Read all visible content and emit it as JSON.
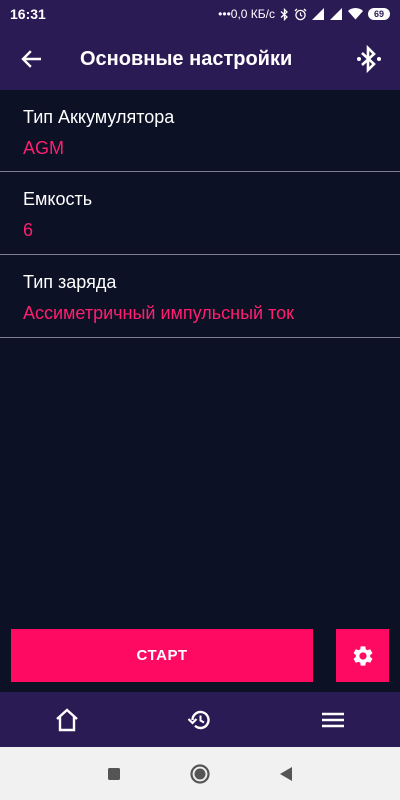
{
  "status_bar": {
    "time": "16:31",
    "network_speed": "0,0 КБ/с",
    "battery_level": "69"
  },
  "app_bar": {
    "title": "Основные настройки"
  },
  "settings": [
    {
      "label": "Тип Аккумулятора",
      "value": "AGM"
    },
    {
      "label": "Емкость",
      "value": "6"
    },
    {
      "label": "Тип заряда",
      "value": "Ассиметричный импульсный ток"
    }
  ],
  "actions": {
    "start_label": "СТАРТ"
  },
  "icons": {
    "back": "arrow-back-icon",
    "bluetooth": "bluetooth-searching-icon",
    "settings": "gear-icon",
    "home": "home-icon",
    "history": "history-icon",
    "menu": "menu-icon"
  },
  "colors": {
    "header_bg": "#2b1b54",
    "page_bg": "#0c1126",
    "accent": "#ff0a63",
    "value_text": "#ff1f6e",
    "divider": "#7c7f91"
  }
}
